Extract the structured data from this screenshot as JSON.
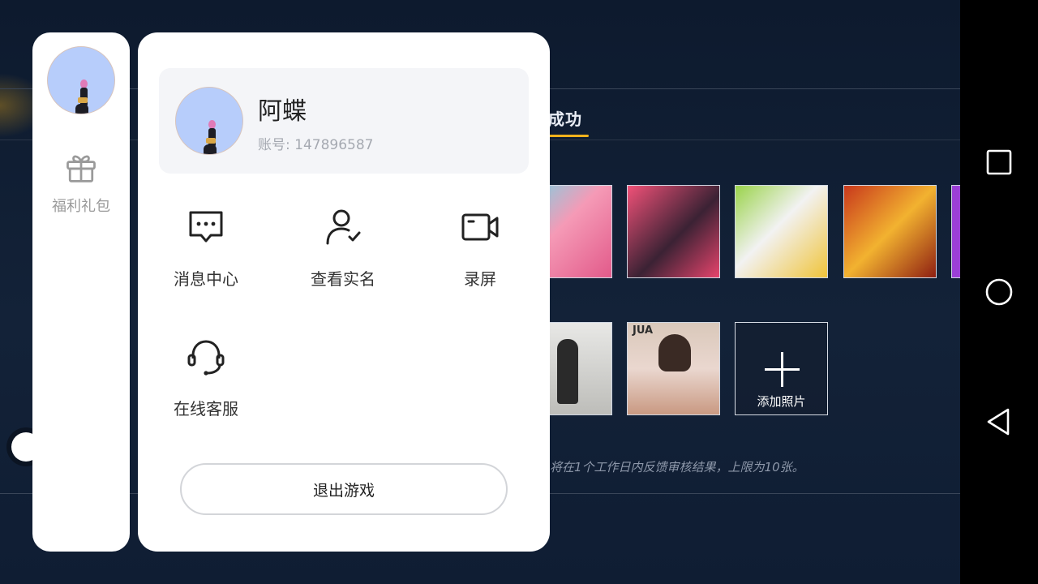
{
  "background": {
    "tab_title": "成功",
    "tiles_row1": [
      "game-char-pink-girl",
      "game-char-dark-hair",
      "game-char-white-cow",
      "game-char-red-chest",
      "game-char-purple"
    ],
    "tiles_row2": [
      "photo-silhouette",
      "photo-woman"
    ],
    "tile_label_jua": "JUA",
    "add_photo_label": "添加照片",
    "hint_text": "将在1个工作日内反馈审核结果，上限为10张。",
    "accent_color": "#f1b21c"
  },
  "sidebar": {
    "avatar_icon": "avatar-girl",
    "gift_icon": "gift-icon",
    "gift_label": "福利礼包"
  },
  "profile": {
    "name": "阿蝶",
    "account_label": "账号:",
    "account_number": "147896587"
  },
  "menu": {
    "items": [
      {
        "label": "消息中心",
        "icon": "message-icon"
      },
      {
        "label": "查看实名",
        "icon": "user-check-icon"
      },
      {
        "label": "录屏",
        "icon": "video-camera-icon"
      },
      {
        "label": "在线客服",
        "icon": "headset-icon"
      }
    ]
  },
  "exit_label": "退出游戏",
  "navbar": {
    "icons": [
      "recent-apps-icon",
      "home-icon",
      "back-icon"
    ]
  }
}
